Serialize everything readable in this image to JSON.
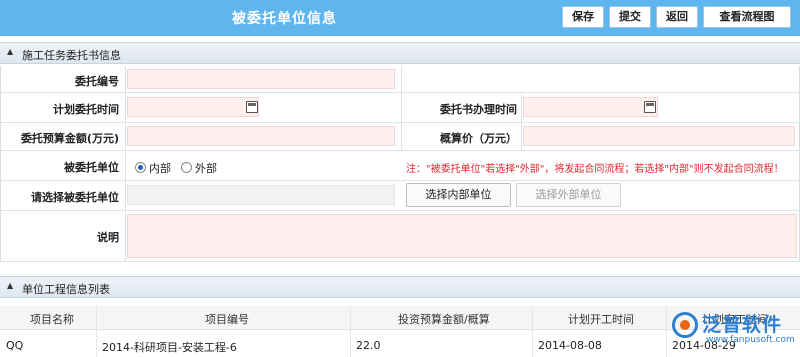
{
  "header": {
    "title": "被委托单位信息",
    "buttons": {
      "save": "保存",
      "submit": "提交",
      "back": "返回",
      "flow": "查看流程图"
    }
  },
  "section1": {
    "title": "施工任务委托书信息",
    "fields": {
      "entrust_no": "委托编号",
      "plan_time": "计划委托时间",
      "letter_time": "委托书办理时间",
      "budget": "委托预算金额(万元)",
      "estimate": "概算价（万元）",
      "unit": "被委托单位",
      "select_unit": "请选择被委托单位",
      "remark": "说明"
    },
    "radio": {
      "internal": "内部",
      "external": "外部",
      "selected": "internal"
    },
    "note": "注：\"被委托单位\"若选择\"外部\"，将发起合同流程；若选择\"内部\"则不发起合同流程！",
    "select_internal": "选择内部单位",
    "select_external": "选择外部单位"
  },
  "section2": {
    "title": "单位工程信息列表",
    "columns": [
      "项目名称",
      "项目编号",
      "投资预算金额/概算",
      "计划开工时间",
      "计划完工时间"
    ],
    "rows": [
      [
        "QQ",
        "2014-科研项目-安装工程-6",
        "22.0",
        "2014-08-08",
        "2014-08-29"
      ]
    ]
  },
  "watermark": {
    "brand": "泛普软件",
    "url": "www.fanpusoft.com"
  },
  "colors": {
    "header_bg": "#5fb6ee",
    "required_bg": "#fff0f0",
    "note": "#e0272b"
  }
}
